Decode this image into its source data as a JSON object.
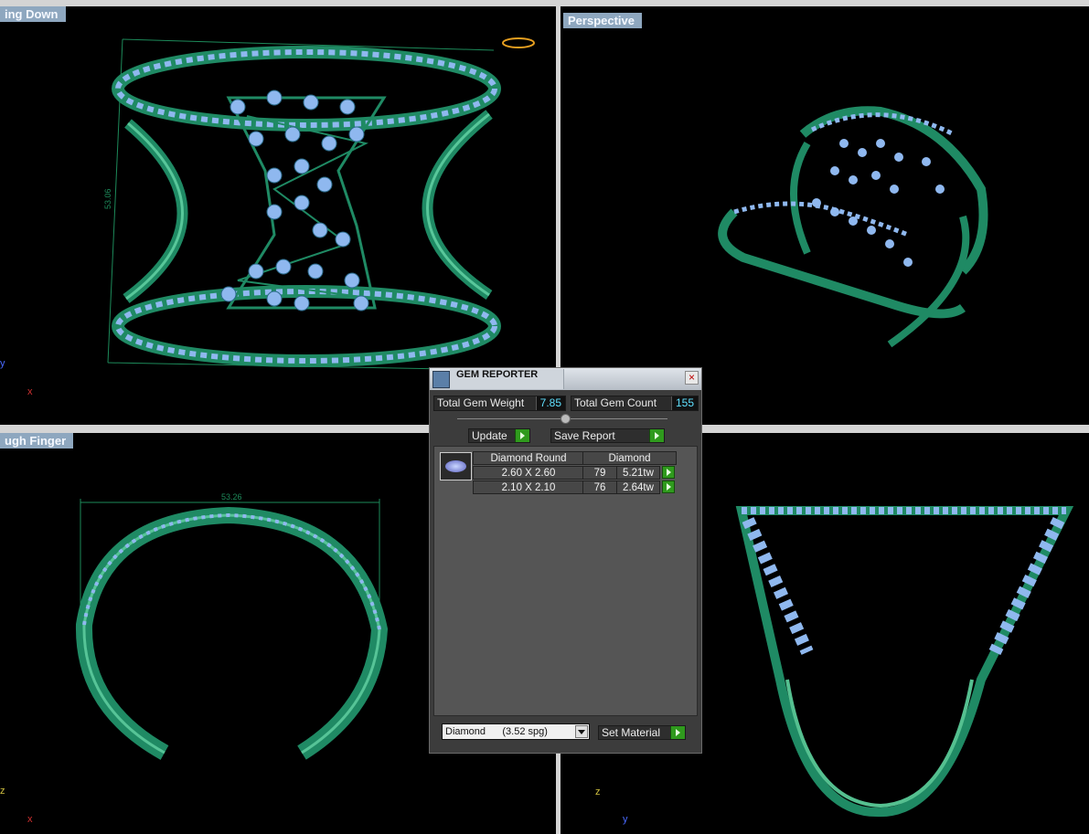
{
  "viewports": [
    {
      "name": "looking-down",
      "label": "ing Down"
    },
    {
      "name": "perspective",
      "label": "Perspective"
    },
    {
      "name": "through-finger",
      "label": "ugh Finger"
    },
    {
      "name": "front",
      "label": ""
    }
  ],
  "dimensions": {
    "height_dim": "53.06",
    "width_dim": "53.26"
  },
  "axes": {
    "x": "x",
    "y": "y",
    "z": "z"
  },
  "gem_reporter": {
    "title": "GEM REPORTER",
    "close": "×",
    "total_weight_label": "Total Gem Weight",
    "total_weight_value": "7.85",
    "total_count_label": "Total Gem Count",
    "total_count_value": "155",
    "update_label": "Update",
    "save_report_label": "Save Report",
    "table": {
      "header_shape": "Diamond Round",
      "header_material": "Diamond",
      "rows": [
        {
          "size": "2.60 X 2.60",
          "count": "79",
          "weight": "5.21tw"
        },
        {
          "size": "2.10 X 2.10",
          "count": "76",
          "weight": "2.64tw"
        }
      ]
    },
    "material_select": "Diamond      (3.52 spg)",
    "set_material_label": "Set Material"
  },
  "colors": {
    "metal": "#1f8a64",
    "gem": "#8fb8ef",
    "panel": "#3c3c3c",
    "accent": "#2f9a1d"
  }
}
